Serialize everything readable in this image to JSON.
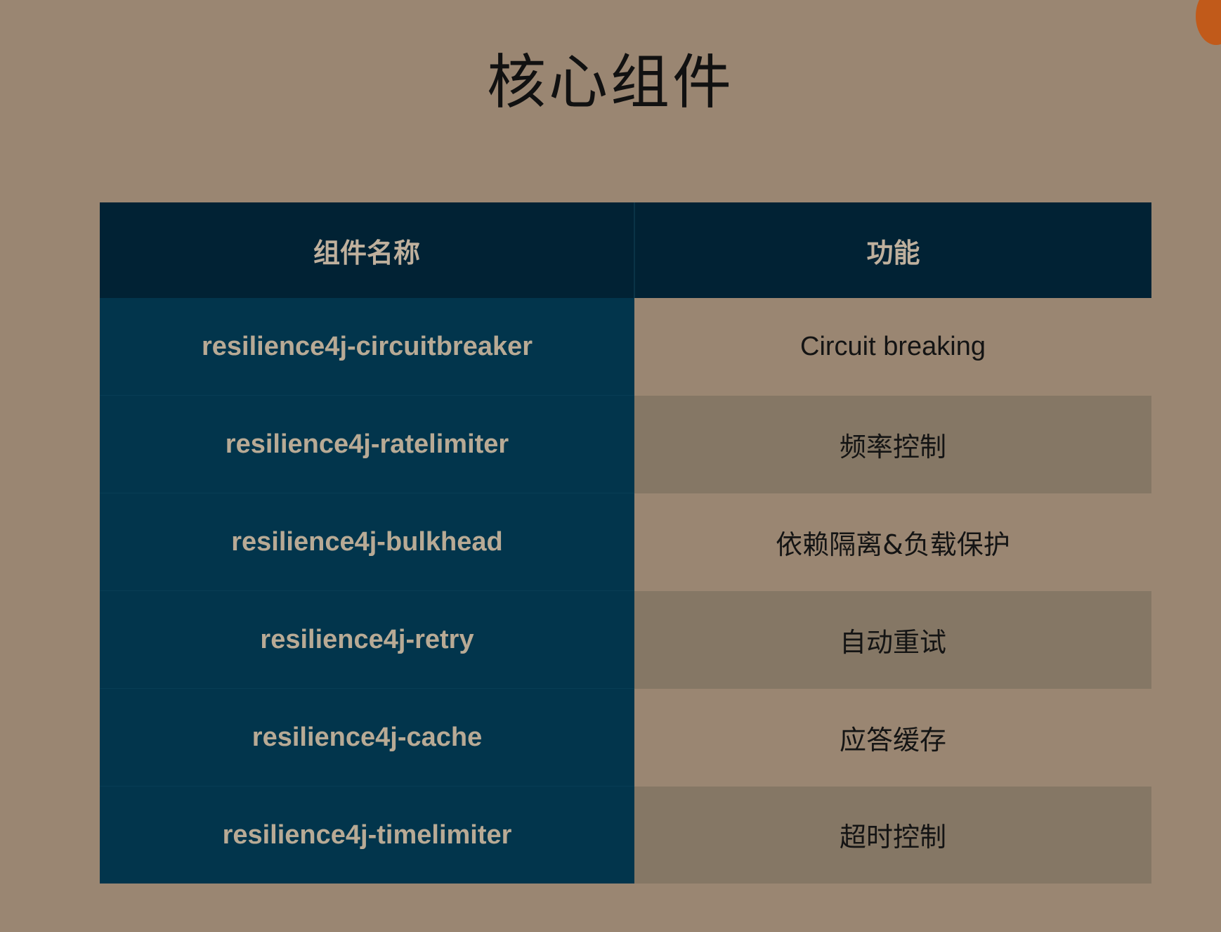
{
  "slide": {
    "title": "核心组件"
  },
  "table": {
    "headers": [
      "组件名称",
      "功能"
    ],
    "rows": [
      {
        "name": "resilience4j-circuitbreaker",
        "function": "Circuit breaking"
      },
      {
        "name": "resilience4j-ratelimiter",
        "function": "频率控制"
      },
      {
        "name": "resilience4j-bulkhead",
        "function": "依赖隔离&负载保护"
      },
      {
        "name": "resilience4j-retry",
        "function": "自动重试"
      },
      {
        "name": "resilience4j-cache",
        "function": "应答缓存"
      },
      {
        "name": "resilience4j-timelimiter",
        "function": "超时控制"
      }
    ]
  },
  "colors": {
    "background": "#9a8672",
    "header_background": "#012234",
    "name_column_background": "#02354c",
    "alternate_row_background": "#857765",
    "corner_mark": "#c15a1a"
  }
}
